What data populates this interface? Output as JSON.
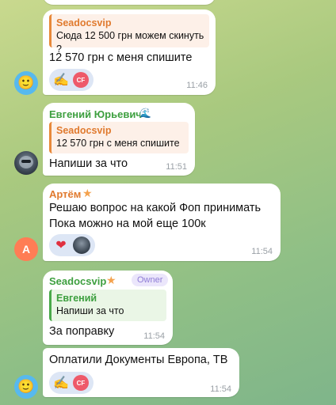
{
  "messages": [
    {
      "quote_name": "Seadocsvip",
      "quote_text": "Сюда 12 500 грн можем скинуть ?",
      "text": "12 570 грн с меня спишите",
      "time": "11:46",
      "reactions": [
        "writing-hand-emoji",
        "cf-avatar"
      ]
    },
    {
      "sender": "Евгений Юрьевич",
      "sender_icon": "🌊",
      "quote_name": "Seadocsvip",
      "quote_text": "12 570 грн с меня спишите",
      "text": "Напиши за что",
      "time": "11:51"
    },
    {
      "sender": "Артём",
      "sender_icon": "★",
      "text_line1": "Решаю вопрос на какой Фоп принимать",
      "text_line2": "Пока можно на мой еще 100к",
      "time": "11:54",
      "reactions": [
        "heart-emoji",
        "user-photo"
      ],
      "avatar_letter": "A"
    },
    {
      "sender": "Seadocsvip",
      "sender_icon": "★",
      "role": "Owner",
      "quote_name": "Евгений",
      "quote_text": "Напиши за что",
      "text": "За поправку",
      "time": "11:54"
    },
    {
      "text": "Оплатили Документы Европа, ТВ",
      "time": "11:54",
      "reactions": [
        "writing-hand-emoji",
        "cf-avatar"
      ]
    }
  ],
  "glyphs": {
    "emoji_avatar": "🙂",
    "writing_hand": "✍",
    "heart": "❤",
    "cf": "CF"
  },
  "colors": {
    "sender_green": "#3d9f3f",
    "sender_orange": "#e07a2e",
    "owner_badge": "#8e7cd6"
  }
}
